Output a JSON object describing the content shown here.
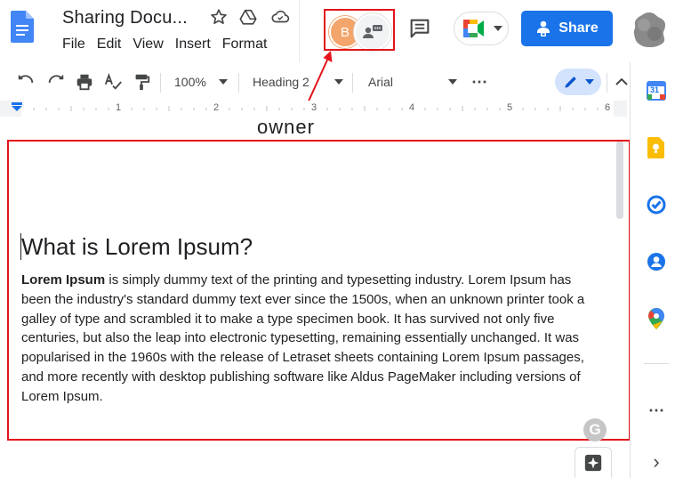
{
  "header": {
    "title": "Sharing Docu...",
    "menus": [
      "File",
      "Edit",
      "View",
      "Insert",
      "Format"
    ],
    "avatar_letter": "B",
    "share_label": "Share"
  },
  "toolbar": {
    "zoom": "100%",
    "style": "Heading 2",
    "font": "Arial",
    "more": "⋯"
  },
  "ruler": {
    "marks": [
      "1",
      "2",
      "3",
      "4",
      "5",
      "6"
    ]
  },
  "annotation": {
    "owner_label": "owner",
    "color": "#e3141b"
  },
  "document": {
    "heading": "What is Lorem Ipsum?",
    "bold_lead": "Lorem Ipsum",
    "body_lines": [
      " is simply dummy text of the printing and typesetting industry. Lorem Ipsum has",
      "been the industry's standard dummy text ever since the 1500s, when an unknown printer took a",
      "galley of type and scrambled it to make a type specimen book. It has survived not only five",
      "centuries, but also the leap into electronic typesetting, remaining essentially unchanged. It was",
      "popularised in the 1960s with the release of Letraset sheets containing Lorem Ipsum passages,",
      "and more recently with desktop publishing software like Aldus PageMaker including versions of",
      "Lorem Ipsum."
    ]
  },
  "side_panel": {
    "calendar_day": "31",
    "more": "⋯",
    "expand": "›"
  },
  "colors": {
    "accent_blue": "#1a73e8",
    "annotation_red": "#e3141b"
  }
}
